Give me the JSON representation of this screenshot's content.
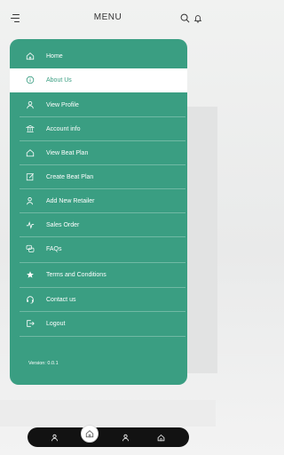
{
  "header": {
    "title": "MENU",
    "left_icon": "hamburger-menu-icon",
    "right_icons": [
      "search-icon",
      "bell-icon"
    ]
  },
  "menu": {
    "accent_color": "#3a9e82",
    "items": [
      {
        "label": "Home",
        "icon": "home-icon",
        "active": false
      },
      {
        "label": "About Us",
        "icon": "info-icon",
        "active": true
      },
      {
        "label": "View Profile",
        "icon": "person-icon",
        "active": false
      },
      {
        "label": "Account info",
        "icon": "bank-icon",
        "active": false
      },
      {
        "label": "View Beat Plan",
        "icon": "house-icon",
        "active": false
      },
      {
        "label": "Create Beat Plan",
        "icon": "edit-icon",
        "active": false
      },
      {
        "label": "Add New Retailer",
        "icon": "add-user-icon",
        "active": false
      },
      {
        "label": "Sales Order",
        "icon": "chart-pulse-icon",
        "active": false
      },
      {
        "label": "FAQs",
        "icon": "chat-icon",
        "active": false
      },
      {
        "label": "Terms and Conditions",
        "icon": "star-icon",
        "active": false
      },
      {
        "label": "Contact us",
        "icon": "headset-icon",
        "active": false
      },
      {
        "label": "Logout",
        "icon": "logout-icon",
        "active": false
      }
    ],
    "version": "Version: 0.0.1"
  },
  "bottom_nav": {
    "items": [
      "person-icon",
      "home-icon",
      "user-group-icon",
      "house-icon"
    ],
    "selected": "home-icon"
  }
}
